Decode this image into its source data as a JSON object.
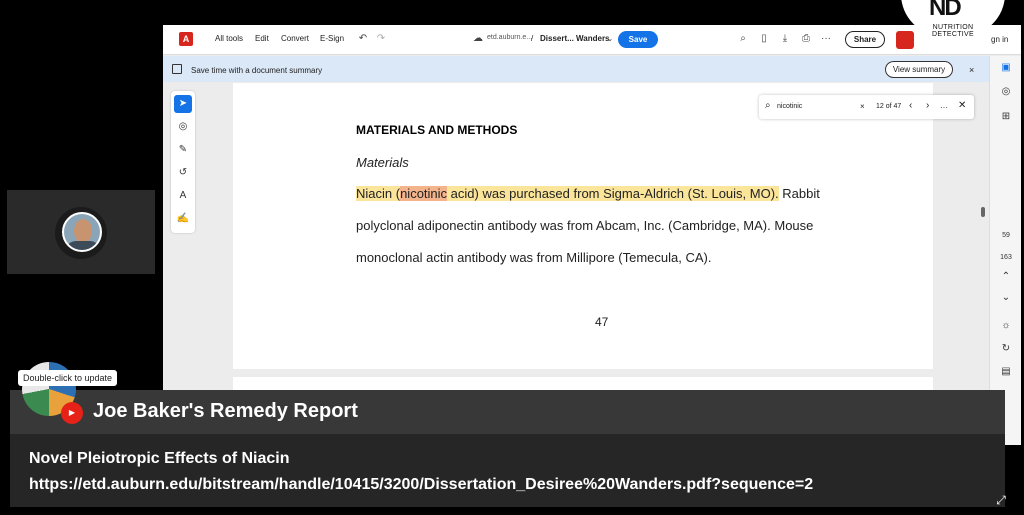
{
  "toolbar": {
    "all_tools": "All tools",
    "edit": "Edit",
    "convert": "Convert",
    "esign": "E-Sign",
    "domain": "etd.auburn.e...",
    "separator": "/",
    "doc_title": "Dissert... Wanders",
    "save": "Save",
    "share": "Share",
    "sign_in": "gn in"
  },
  "banner": {
    "text": "Save time with a document summary",
    "view_summary": "View summary",
    "close": "×"
  },
  "find": {
    "query": "nicotinic",
    "clear": "×",
    "count": "12 of 47",
    "prev": "‹",
    "next": "›",
    "more": "···",
    "close": "✕"
  },
  "document": {
    "heading": "MATERIALS AND METHODS",
    "subheading": "Materials",
    "line1_pre": "Niacin (",
    "line1_match": "nicotinic",
    "line1_post": " acid) was purchased from Sigma-Aldrich (St. Louis, MO).",
    "line1_tail": "  Rabbit",
    "line2": "polyclonal adiponectin antibody was from Abcam, Inc. (Cambridge, MA).  Mouse",
    "line3": "monoclonal actin antibody was from Millipore (Temecula, CA).",
    "page_number": "47"
  },
  "right_rail": {
    "page_current": "59",
    "page_total": "163"
  },
  "brand": {
    "logo_text": "NUTRITION DETECTIVE"
  },
  "overlay": {
    "tooltip": "Double-click to update",
    "channel_title": "Joe Baker's Remedy Report",
    "line1": "Novel Pleiotropic Effects of Niacin",
    "line2": "https://etd.auburn.edu/bitstream/handle/10415/3200/Dissertation_Desiree%20Wanders.pdf?sequence=2"
  },
  "colors": {
    "accent": "#1473e6",
    "adobe_red": "#d7261e",
    "highlight": "#fbe59a",
    "current_match": "#f3b38b"
  }
}
